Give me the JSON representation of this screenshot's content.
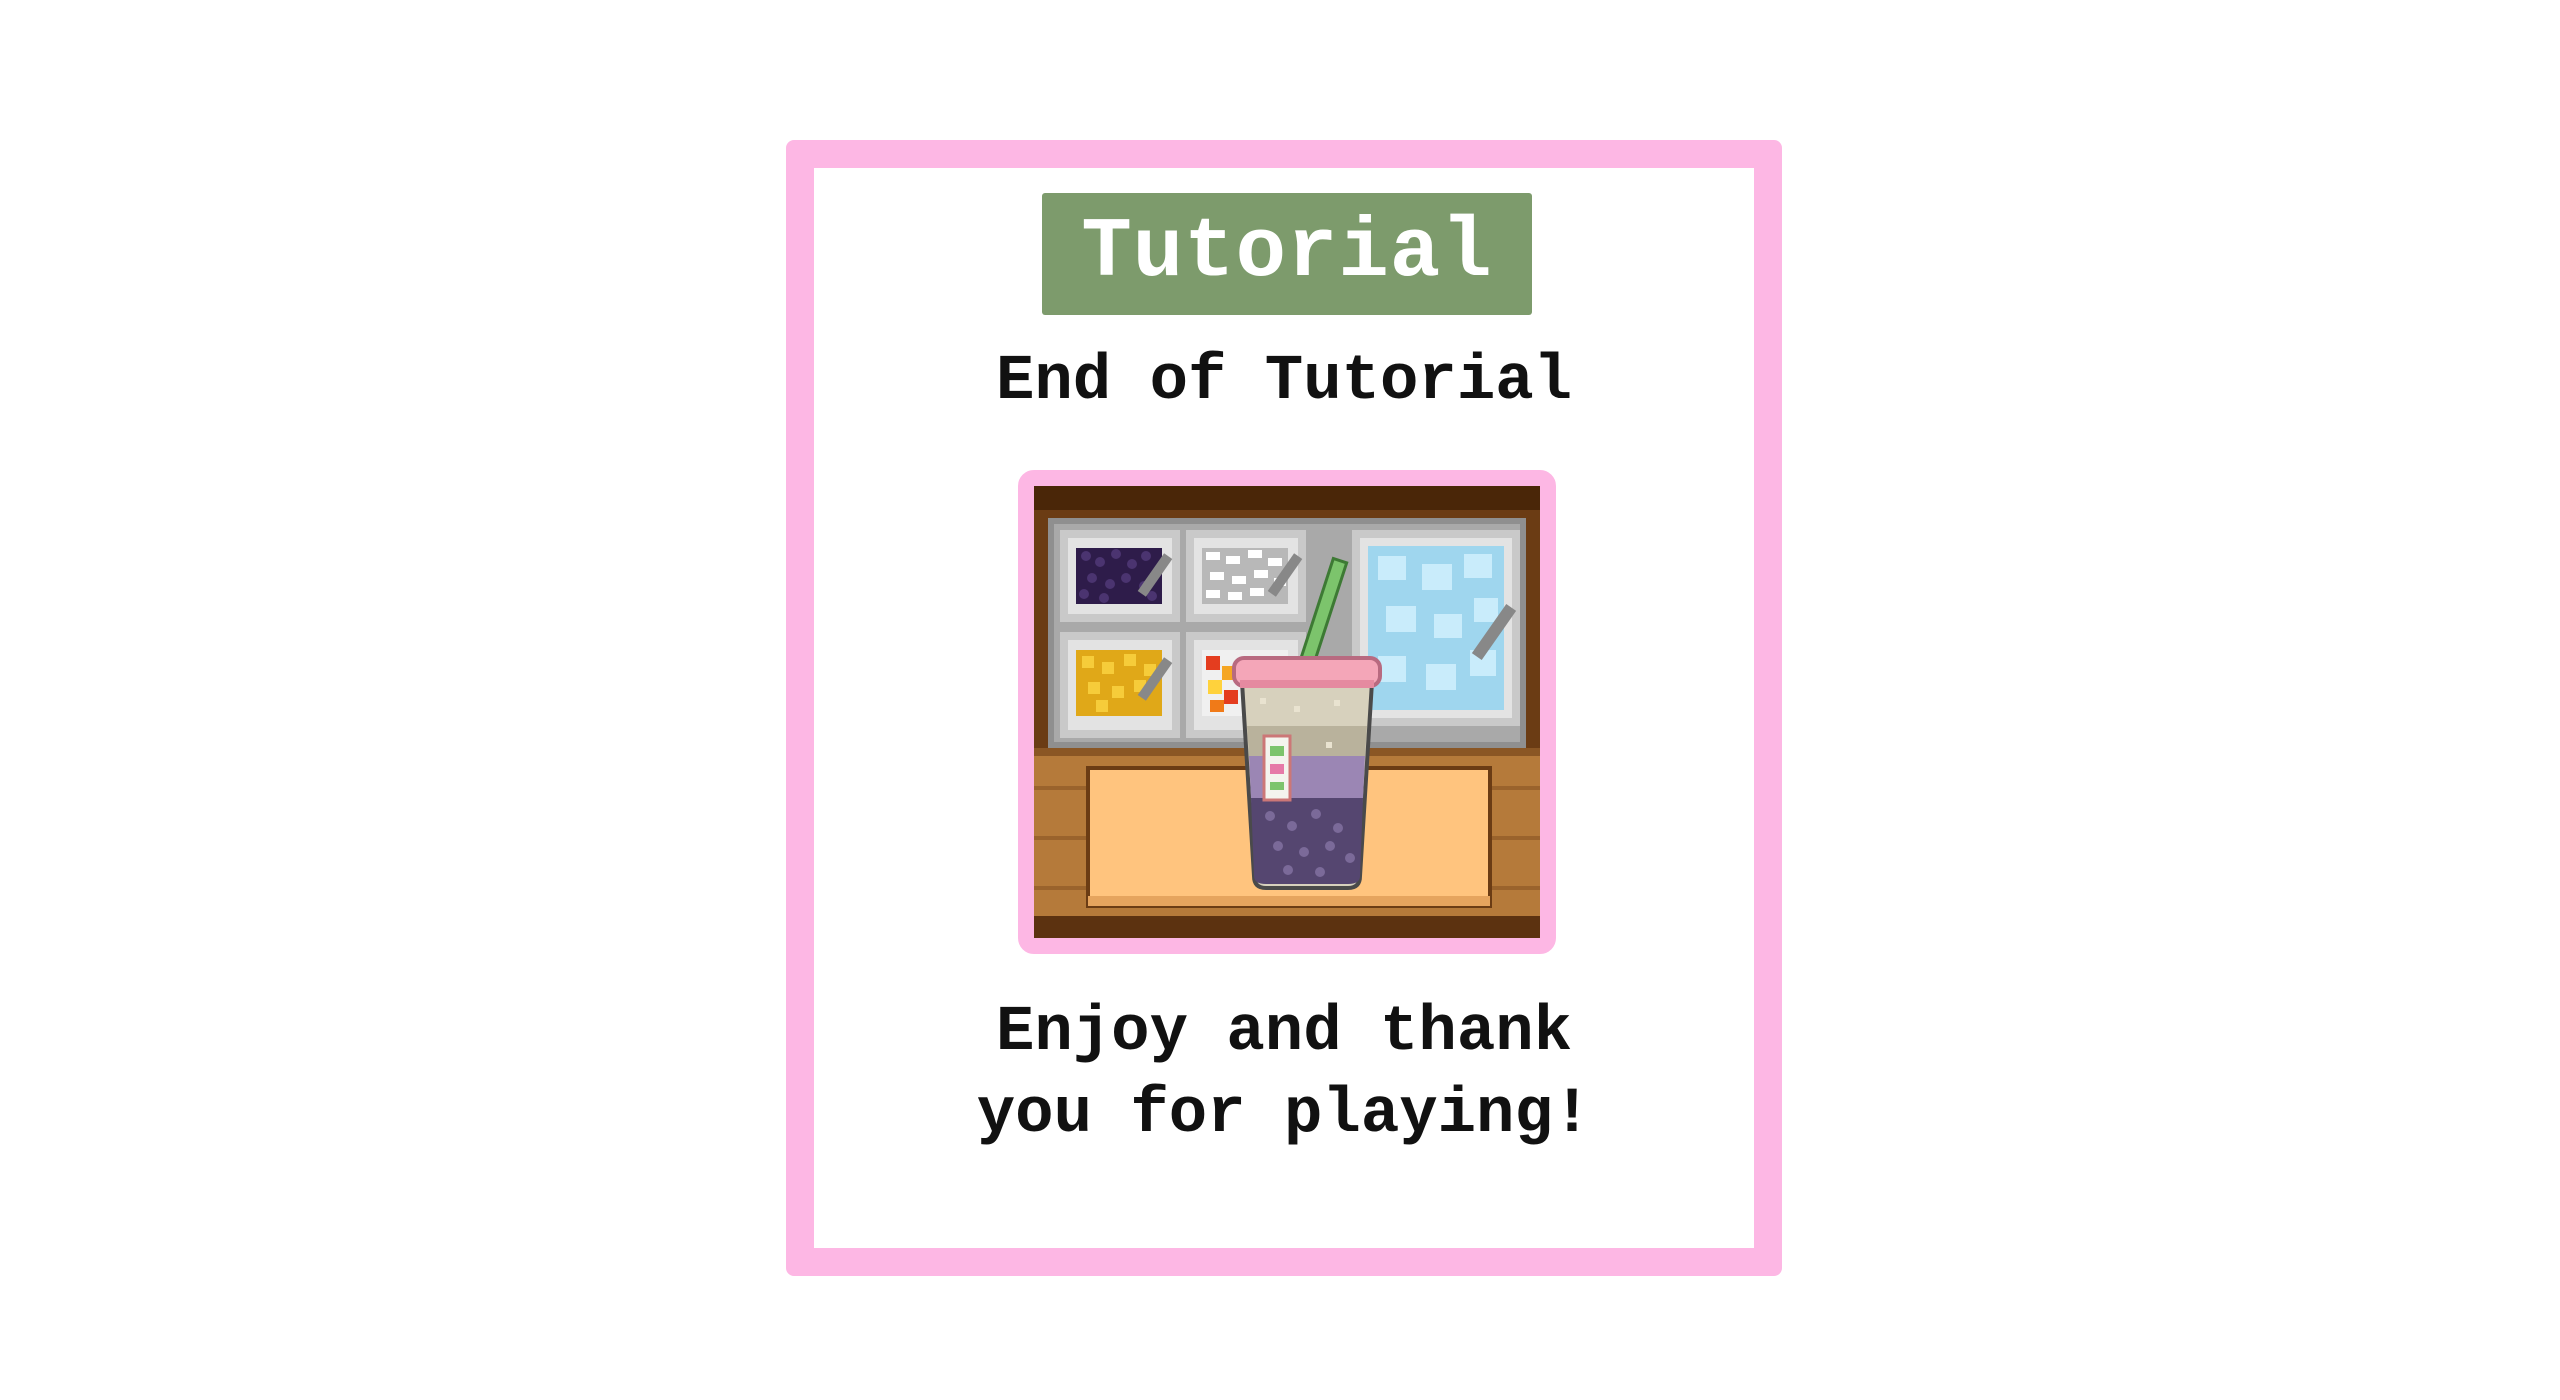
{
  "dialog": {
    "badge_label": "Tutorial",
    "subtitle": "End of Tutorial",
    "message_line1": "Enjoy and thank",
    "message_line2": "you for playing!"
  },
  "scene": {
    "image_name": "boba-shop-counter-illustration",
    "toppings": [
      "taro-pearls",
      "coconut-jelly",
      "crushed-ice",
      "mango-jelly",
      "fruit-jelly"
    ]
  },
  "colors": {
    "frame_pink": "#fdb7e4",
    "badge_green": "#7d9b6c",
    "text": "#111111"
  }
}
